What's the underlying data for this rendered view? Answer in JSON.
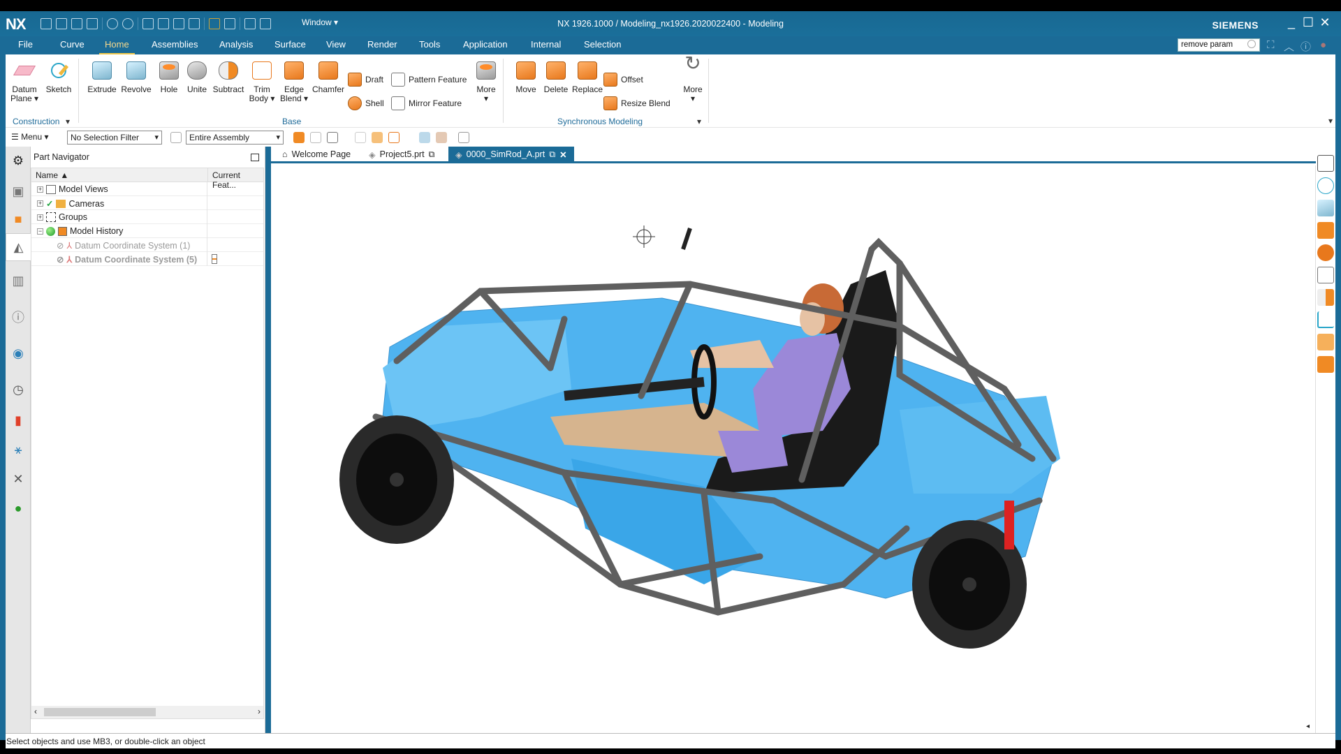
{
  "window": {
    "logo": "NX",
    "title": "NX 1926.1000 / Modeling_nx1926.2020022400 - Modeling",
    "brand": "SIEMENS",
    "window_menu": "Window ▾",
    "minimize": "_",
    "maximize": "☐",
    "close": "✕"
  },
  "menu": {
    "tabs": [
      "File",
      "Curve",
      "Home",
      "Assemblies",
      "Analysis",
      "Surface",
      "View",
      "Render",
      "Tools",
      "Application",
      "Internal",
      "Selection"
    ],
    "active": "Home",
    "search_value": "remove param"
  },
  "ribbon": {
    "construction": {
      "label": "Construction",
      "buttons": [
        "Datum Plane ▾",
        "Sketch"
      ]
    },
    "base": {
      "label": "Base",
      "buttons": [
        "Extrude",
        "Revolve",
        "Hole",
        "Unite",
        "Subtract",
        "Trim Body ▾",
        "Edge Blend ▾",
        "Chamfer"
      ],
      "small_buttons": [
        "Draft",
        "Shell",
        "Pattern Feature",
        "Mirror Feature"
      ],
      "more": "More"
    },
    "sync": {
      "label": "Synchronous Modeling",
      "buttons": [
        "Move",
        "Delete",
        "Replace"
      ],
      "small_buttons": [
        "Offset",
        "Resize Blend"
      ],
      "more": "More"
    }
  },
  "toolbar2": {
    "menu_label": "Menu ▾",
    "selection_filter": "No Selection Filter",
    "scope": "Entire Assembly"
  },
  "navigator": {
    "title": "Part Navigator",
    "columns": [
      "Name ▲",
      "Current Feat..."
    ],
    "rows": [
      {
        "expander": "+",
        "label": "Model Views",
        "style": "normal"
      },
      {
        "expander": "+",
        "label": "Cameras",
        "style": "normal",
        "check": "✓"
      },
      {
        "expander": "+",
        "label": "Groups",
        "style": "normal"
      },
      {
        "expander": "−",
        "label": "Model History",
        "style": "normal"
      },
      {
        "expander": "",
        "label": "Datum Coordinate System (1)",
        "style": "dim"
      },
      {
        "expander": "",
        "label": "Datum Coordinate System (5)",
        "style": "dim-bold"
      }
    ]
  },
  "tabs": [
    {
      "label": "Welcome Page",
      "icon": "home-icon"
    },
    {
      "label": "Project5.prt",
      "icon": "part-icon"
    },
    {
      "label": "0000_SimRod_A.prt",
      "icon": "part-icon",
      "active": true,
      "close": "✕"
    }
  ],
  "model": {
    "name": "SimRod vehicle assembly with driver"
  },
  "colors": {
    "accent": "#1b6b97",
    "body_blue": "#4fb3f0",
    "frame_gray": "#666666",
    "feature_orange": "#f08a24"
  },
  "status": {
    "text": "Select objects and use MB3, or double-click an object"
  }
}
